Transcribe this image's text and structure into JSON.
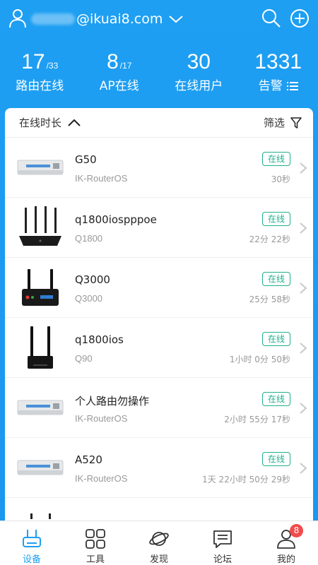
{
  "header": {
    "account_suffix": "@ikuai8.com"
  },
  "stats": [
    {
      "value": "17",
      "sub": "/33",
      "label": "路由在线"
    },
    {
      "value": "8",
      "sub": "/17",
      "label": "AP在线"
    },
    {
      "value": "30",
      "sub": "",
      "label": "在线用户"
    },
    {
      "value": "1331",
      "sub": "",
      "label": "告警"
    }
  ],
  "list_header": {
    "sort_label": "在线时长",
    "filter_label": "筛选"
  },
  "devices": [
    {
      "name": "G50",
      "model": "IK-RouterOS",
      "status": "在线",
      "duration": "30秒",
      "image": "router-box-icon"
    },
    {
      "name": "q1800iospppoe",
      "model": "Q1800",
      "status": "在线",
      "duration": "22分 22秒",
      "image": "router-antenna4-icon"
    },
    {
      "name": "Q3000",
      "model": "Q3000",
      "status": "在线",
      "duration": "25分 58秒",
      "image": "router-antenna2-icon"
    },
    {
      "name": "q1800ios",
      "model": "Q90",
      "status": "在线",
      "duration": "1小时 0分 50秒",
      "image": "router-tall-icon"
    },
    {
      "name": "个人路由勿操作",
      "model": "IK-RouterOS",
      "status": "在线",
      "duration": "2小时 55分 17秒",
      "image": "router-box-icon"
    },
    {
      "name": "A520",
      "model": "IK-RouterOS",
      "status": "在线",
      "duration": "1天 22小时 50分 29秒",
      "image": "router-box-icon"
    }
  ],
  "nav": [
    {
      "label": "设备",
      "icon": "router-icon",
      "active": true
    },
    {
      "label": "工具",
      "icon": "grid-icon",
      "active": false
    },
    {
      "label": "发现",
      "icon": "planet-icon",
      "active": false
    },
    {
      "label": "论坛",
      "icon": "chat-icon",
      "active": false
    },
    {
      "label": "我的",
      "icon": "person-icon",
      "active": false,
      "badge": "8"
    }
  ],
  "colors": {
    "primary": "#1e9ff2",
    "online": "#20b08a",
    "badge": "#f24b4b"
  }
}
